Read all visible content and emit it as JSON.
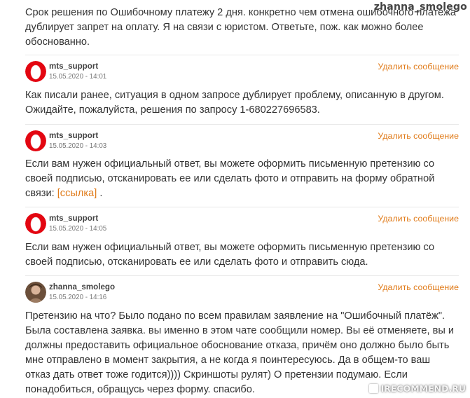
{
  "watermark_user": "zhanna_smolego",
  "watermark_site": "IRECOMMEND.RU",
  "top_text": "Срок решения по Ошибочному платежу 2 дня. конкретно чем отмена ошибочного платежа дублирует запрет на оплату. Я на связи с юристом. Ответьте, пож. как можно более обоснованно.",
  "replies": [
    {
      "author": "mts_support",
      "date": "15.05.2020 - 14:01",
      "delete_label": "Удалить сообщение",
      "text": "Как писали ранее, ситуация в одном запросе дублирует проблему, описанную в другом. Ожидайте, пожалуйста, решения по запросу 1-680227696583."
    },
    {
      "author": "mts_support",
      "date": "15.05.2020 - 14:03",
      "delete_label": "Удалить сообщение",
      "text": "Если вам нужен официальный ответ, вы можете оформить письменную претензию со своей подписью, отсканировать ее или сделать фото и отправить на форму обратной связи:",
      "link_text": "[ссылка]",
      "text_after": " ."
    },
    {
      "author": "mts_support",
      "date": "15.05.2020 - 14:05",
      "delete_label": "Удалить сообщение",
      "text": "Если вам нужен официальный ответ, вы можете оформить письменную претензию со своей подписью, отсканировать ее или сделать фото и отправить сюда."
    },
    {
      "author": "zhanna_smolego",
      "date": "15.05.2020 - 14:16",
      "delete_label": "Удалить сообщение",
      "text": "Претензию на что? Было подано по всем правилам заявление на \"Ошибочный платёж\". Была составлена заявка. вы именно в этом чате сообщили номер. Вы её отменяете, вы и должны предоставить официальное обоснование отказа, причём оно должно было быть мне отправлено в момент закрытия, а не когда я поинтересуюсь. Да в общем-то ваш отказ дать ответ тоже годится)))) Скриншоты рулят) О претензии подумаю. Если понадобиться, обращусь через форму. спасибо."
    }
  ]
}
